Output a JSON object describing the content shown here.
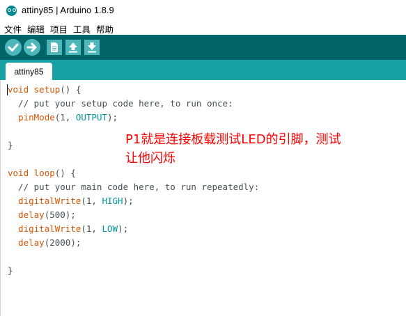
{
  "window": {
    "title": "attiny85 | Arduino 1.8.9"
  },
  "menu": [
    "文件",
    "编辑",
    "项目",
    "工具",
    "帮助"
  ],
  "toolbar": {
    "buttons": [
      "verify-icon",
      "upload-icon",
      "new-icon",
      "open-icon",
      "save-icon"
    ]
  },
  "tabs": [
    {
      "label": "attiny85"
    }
  ],
  "code": {
    "l1": {
      "kw": "void",
      "fn": "setup",
      "rest": "() {"
    },
    "l2": "  // put your setup code here, to run once:",
    "l3": {
      "fn": "pinMode",
      "pre": "(1, ",
      "const": "OUTPUT",
      "post": ");"
    },
    "l5": "}",
    "l7": {
      "kw": "void",
      "fn": "loop",
      "rest": "() {"
    },
    "l8": "  // put your main code here, to run repeatedly:",
    "l9": {
      "fn": "digitalWrite",
      "pre": "(1, ",
      "const": "HIGH",
      "post": ");"
    },
    "l10": {
      "fn": "delay",
      "rest": "(500);"
    },
    "l11": {
      "fn": "digitalWrite",
      "pre": "(1, ",
      "const": "LOW",
      "post": ");"
    },
    "l12": {
      "fn": "delay",
      "rest": "(2000);"
    },
    "l15": "}"
  },
  "annotation": {
    "line1": "P1就是连接板载测试LED的引脚，测试",
    "line2": "让他闪烁"
  },
  "colors": {
    "toolbar": "#006468",
    "tabstrip": "#17a1a5",
    "button": "#4db7bb",
    "keyword": "#d35400",
    "constant": "#00979c",
    "annotation": "#ff0000"
  }
}
